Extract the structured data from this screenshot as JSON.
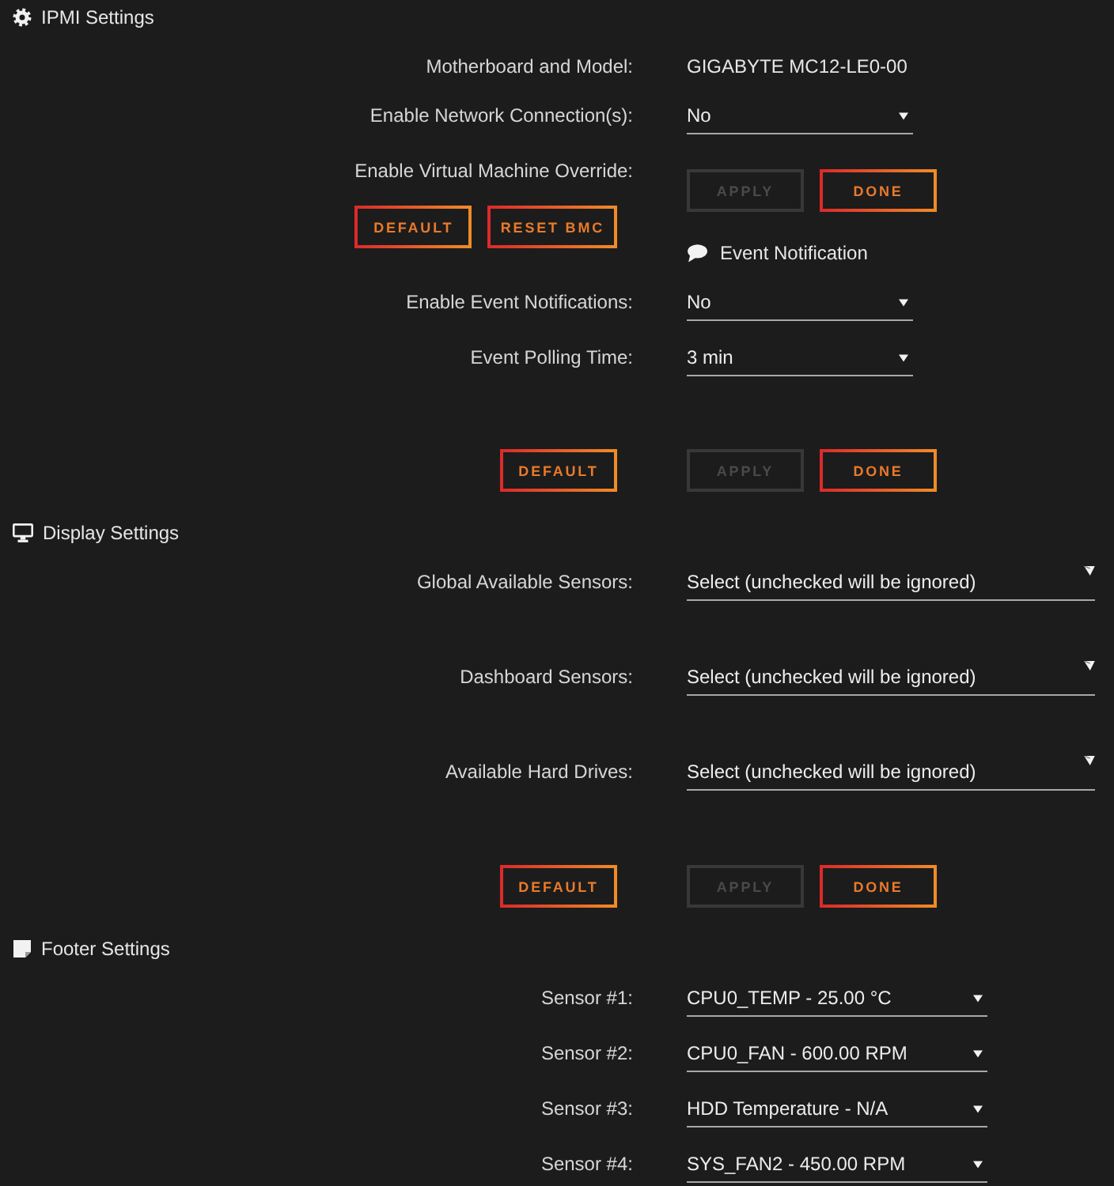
{
  "sections": [
    {
      "kind": "ipmi",
      "title": "IPMI Settings",
      "rows": [
        {
          "left": [
            {
              "kind": "label",
              "text": "Motherboard and Model:"
            }
          ],
          "right": [
            {
              "kind": "text",
              "text": "GIGABYTE MC12-LE0-00"
            }
          ]
        },
        {
          "left": [
            {
              "kind": "label",
              "text": "Enable Network Connection(s):"
            }
          ],
          "right": [
            {
              "kind": "select",
              "value": "No"
            }
          ]
        },
        {
          "left": [
            {
              "kind": "label",
              "text": "Enable Virtual Machine Override:"
            },
            {
              "kind": "buttons",
              "buttons": [
                {
                  "label": "DEFAULT",
                  "disabled": false
                },
                {
                  "label": "RESET BMC",
                  "disabled": false
                }
              ]
            }
          ],
          "right": [
            {
              "kind": "buttons",
              "buttons": [
                {
                  "label": "APPLY",
                  "disabled": true
                },
                {
                  "label": "DONE",
                  "disabled": false
                }
              ]
            },
            {
              "kind": "subheading",
              "text": "Event Notification"
            }
          ]
        },
        {
          "left": [
            {
              "kind": "label",
              "text": "Enable Event Notifications:"
            }
          ],
          "right": [
            {
              "kind": "select",
              "value": "No"
            }
          ]
        },
        {
          "left": [
            {
              "kind": "label",
              "text": "Event Polling Time:"
            }
          ],
          "right": [
            {
              "kind": "select",
              "value": "3 min"
            }
          ]
        },
        {
          "left": [
            {
              "kind": "buttons",
              "buttons": [
                {
                  "label": "DEFAULT",
                  "disabled": false
                }
              ]
            }
          ],
          "right": [
            {
              "kind": "buttons",
              "buttons": [
                {
                  "label": "APPLY",
                  "disabled": true
                },
                {
                  "label": "DONE",
                  "disabled": false
                }
              ]
            }
          ]
        }
      ]
    },
    {
      "kind": "display",
      "title": "Display Settings",
      "rows": [
        {
          "left": [
            {
              "kind": "label",
              "text": "Global Available Sensors:"
            }
          ],
          "right": [
            {
              "kind": "multiselect",
              "placeholder": "Select (unchecked will be ignored)"
            }
          ]
        },
        {
          "left": [
            {
              "kind": "label",
              "text": "Dashboard Sensors:"
            }
          ],
          "right": [
            {
              "kind": "multiselect",
              "placeholder": "Select (unchecked will be ignored)"
            }
          ]
        },
        {
          "left": [
            {
              "kind": "label",
              "text": "Available Hard Drives:"
            }
          ],
          "right": [
            {
              "kind": "multiselect",
              "placeholder": "Select (unchecked will be ignored)"
            }
          ]
        },
        {
          "left": [
            {
              "kind": "buttons",
              "buttons": [
                {
                  "label": "DEFAULT",
                  "disabled": false
                }
              ]
            }
          ],
          "right": [
            {
              "kind": "buttons",
              "buttons": [
                {
                  "label": "APPLY",
                  "disabled": true
                },
                {
                  "label": "DONE",
                  "disabled": false
                }
              ]
            }
          ]
        }
      ]
    },
    {
      "kind": "footer",
      "title": "Footer Settings",
      "rows": [
        {
          "left": [
            {
              "kind": "label",
              "text": "Sensor #1:"
            }
          ],
          "right": [
            {
              "kind": "select",
              "value": "CPU0_TEMP - 25.00 °C"
            }
          ]
        },
        {
          "left": [
            {
              "kind": "label",
              "text": "Sensor #2:"
            }
          ],
          "right": [
            {
              "kind": "select",
              "value": "CPU0_FAN - 600.00 RPM"
            }
          ]
        },
        {
          "left": [
            {
              "kind": "label",
              "text": "Sensor #3:"
            }
          ],
          "right": [
            {
              "kind": "select",
              "value": "HDD Temperature - N/A"
            }
          ]
        },
        {
          "left": [
            {
              "kind": "label",
              "text": "Sensor #4:"
            }
          ],
          "right": [
            {
              "kind": "select",
              "value": "SYS_FAN2 - 450.00 RPM"
            }
          ]
        }
      ]
    }
  ]
}
